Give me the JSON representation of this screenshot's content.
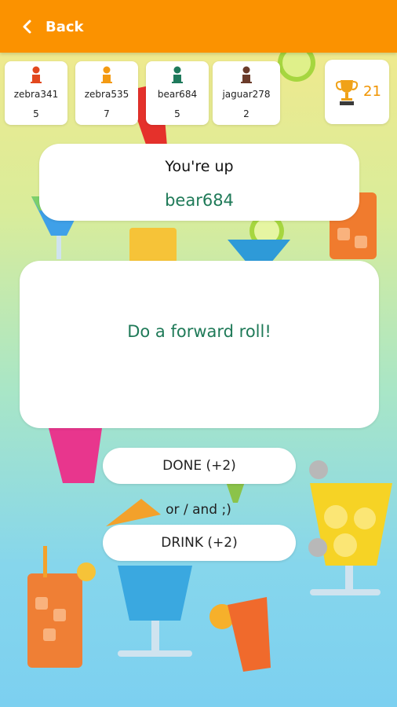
{
  "header": {
    "back_label": "Back",
    "background_color": "#fb9200"
  },
  "players": [
    {
      "name": "zebra341",
      "score": "5",
      "pawn_color": "#e2481e"
    },
    {
      "name": "zebra535",
      "score": "7",
      "pawn_color": "#f39a12"
    },
    {
      "name": "bear684",
      "score": "5",
      "pawn_color": "#1f7a5c"
    },
    {
      "name": "jaguar278",
      "score": "2",
      "pawn_color": "#6b3b2a"
    }
  ],
  "goal": {
    "icon": "trophy-icon",
    "value": "21"
  },
  "turn": {
    "label": "You're up",
    "player": "bear684"
  },
  "task": {
    "text": "Do a forward roll!"
  },
  "actions": {
    "done_label": "DONE (+2)",
    "or_label": "or / and ;)",
    "drink_label": "DRINK (+2)"
  }
}
